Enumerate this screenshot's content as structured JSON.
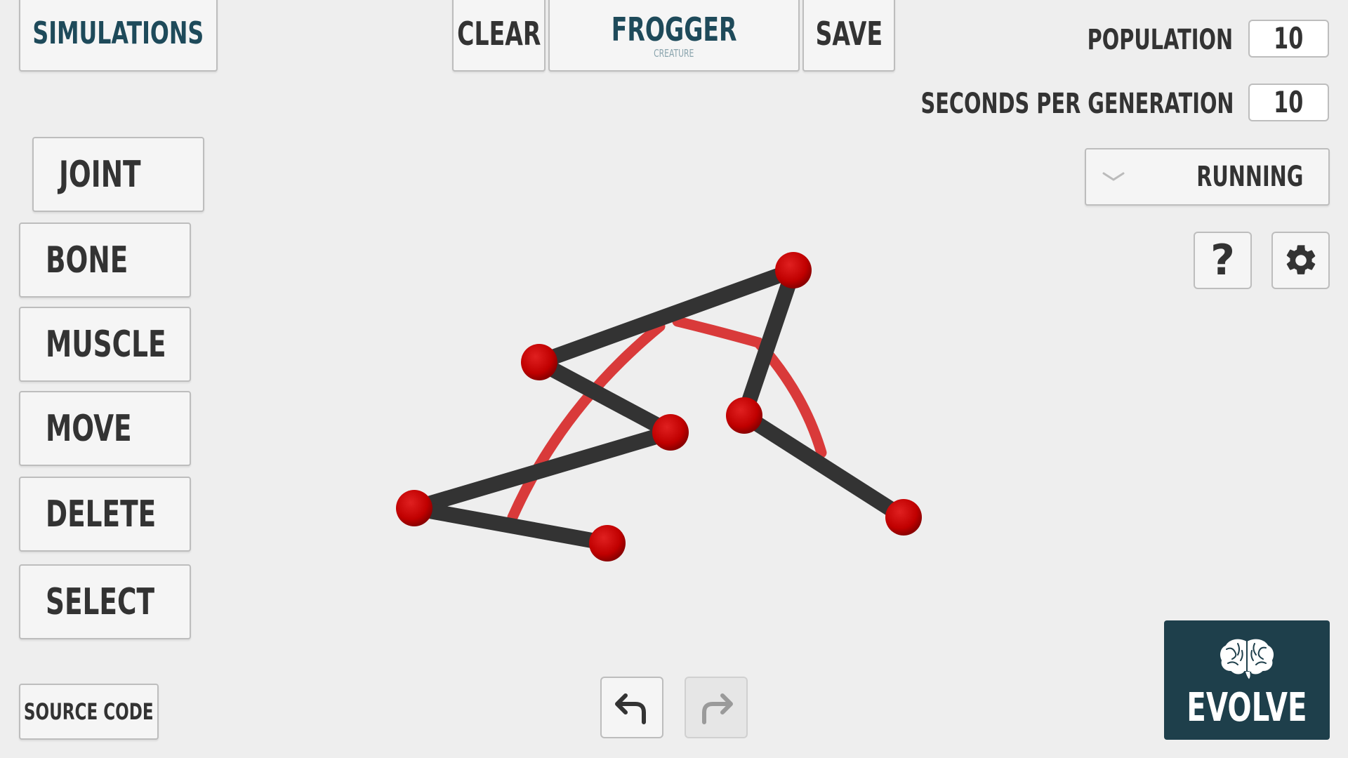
{
  "top_bar": {
    "simulations_label": "SIMULATIONS",
    "clear_label": "CLEAR",
    "creature_name": "FROGGER",
    "creature_sublabel": "CREATURE",
    "save_label": "SAVE"
  },
  "tools": {
    "joint": "JOINT",
    "bone": "BONE",
    "muscle": "MUSCLE",
    "move": "MOVE",
    "delete": "DELETE",
    "select": "SELECT"
  },
  "footer": {
    "source_code_label": "SOURCE CODE",
    "evolve_label": "EVOLVE"
  },
  "settings": {
    "population_label": "POPULATION",
    "population_value": "10",
    "seconds_label": "SECONDS PER GENERATION",
    "seconds_value": "10",
    "task_selected": "RUNNING",
    "help_glyph": "?"
  },
  "icons": {
    "help": "question-mark-icon",
    "settings": "gear-icon",
    "undo": "undo-arrow-icon",
    "redo": "redo-arrow-icon",
    "evolve": "brain-icon",
    "dropdown": "chevron-down-icon"
  },
  "colors": {
    "background": "#eeeeee",
    "title_teal": "#1e4a5a",
    "evolve_bg": "#1e3f4b",
    "joint_red": "#cc0000",
    "bone_dark": "#333333",
    "muscle_red": "#d93a3a",
    "text_dark": "#333333"
  }
}
